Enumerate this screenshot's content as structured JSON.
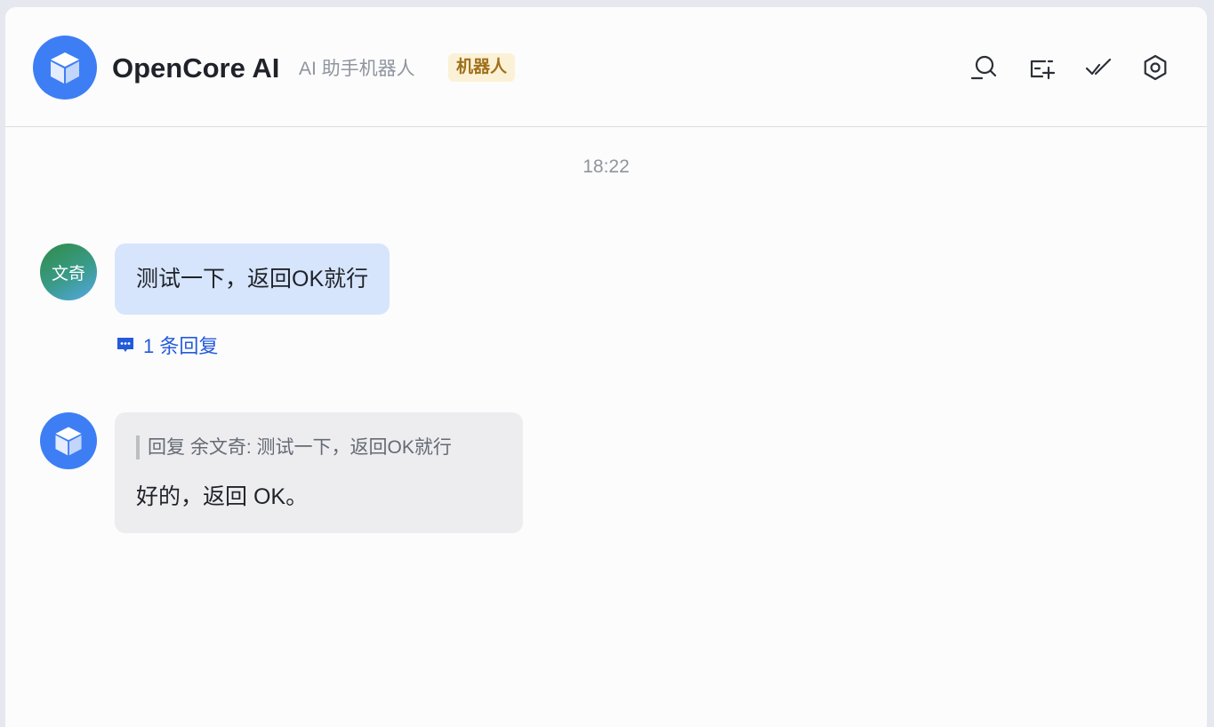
{
  "header": {
    "title": "OpenCore AI",
    "subtitle": "AI 助手机器人",
    "badge": "机器人",
    "actions": [
      "search-icon",
      "add-tab-icon",
      "done-icon",
      "settings-icon"
    ]
  },
  "chat": {
    "timestamp": "18:22",
    "messages": [
      {
        "sender": "user",
        "avatar_text": "文奇",
        "text": "测试一下，返回OK就行",
        "reply_count_label": "1 条回复"
      },
      {
        "sender": "bot",
        "quote": "回复 余文奇: 测试一下，返回OK就行",
        "text": "好的，返回 OK。"
      }
    ]
  },
  "colors": {
    "accent": "#3d7ef5",
    "user_bubble": "#d6e4fc",
    "bot_bubble": "#ededf0",
    "link": "#245bdb",
    "badge_bg": "#fbf1d6",
    "badge_text": "#a0701b"
  }
}
